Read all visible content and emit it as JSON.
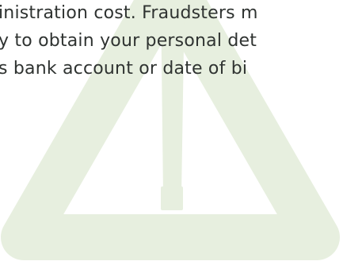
{
  "warning": {
    "icon": "warning-triangle-icon",
    "color": "#e7efdf"
  },
  "text": {
    "lines": [
      "inistration cost. Fraudsters m",
      "y to obtain your personal det",
      "s bank account or date of bi"
    ]
  }
}
